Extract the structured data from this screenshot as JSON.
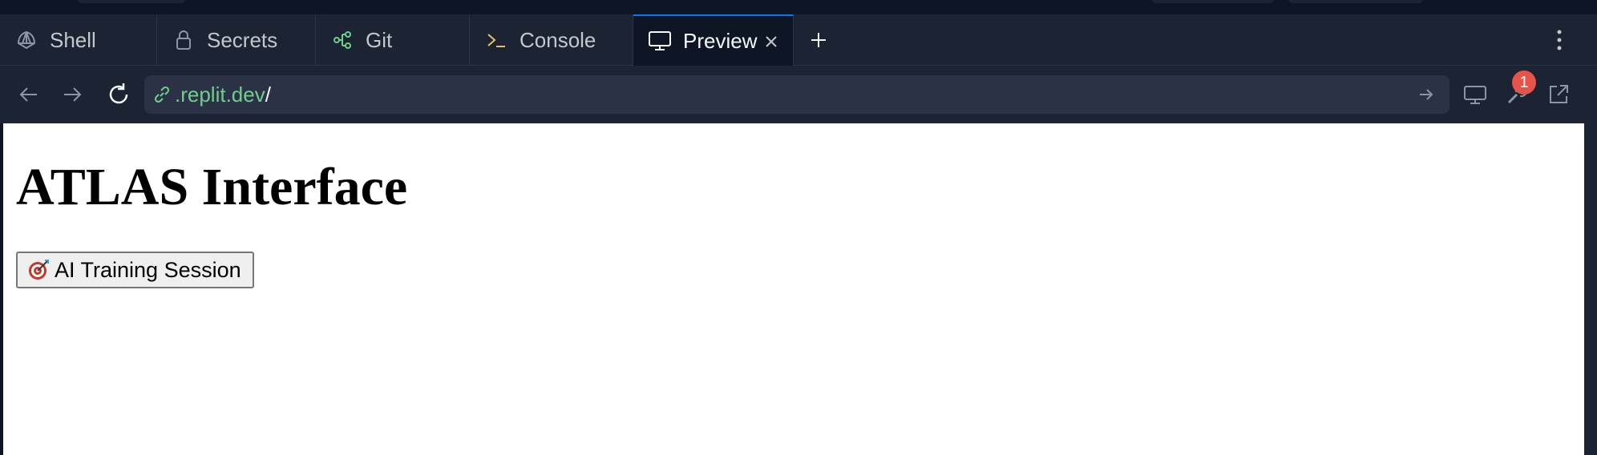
{
  "tabs": [
    {
      "label": "Shell",
      "icon": "shell-icon"
    },
    {
      "label": "Secrets",
      "icon": "lock-icon"
    },
    {
      "label": "Git",
      "icon": "git-branch-icon"
    },
    {
      "label": "Console",
      "icon": "terminal-icon"
    },
    {
      "label": "Preview",
      "icon": "monitor-icon",
      "active": true
    }
  ],
  "url": {
    "host": ".replit.dev",
    "path": "/"
  },
  "notifications": {
    "count": "1"
  },
  "page": {
    "heading": "ATLAS Interface",
    "button_label": "AI Training Session",
    "button_icon": "target-icon"
  },
  "colors": {
    "background": "#0e1525",
    "panel": "#1c2333",
    "accent": "#0079f2",
    "url_host": "#6fd08c",
    "badge": "#e5534b"
  }
}
